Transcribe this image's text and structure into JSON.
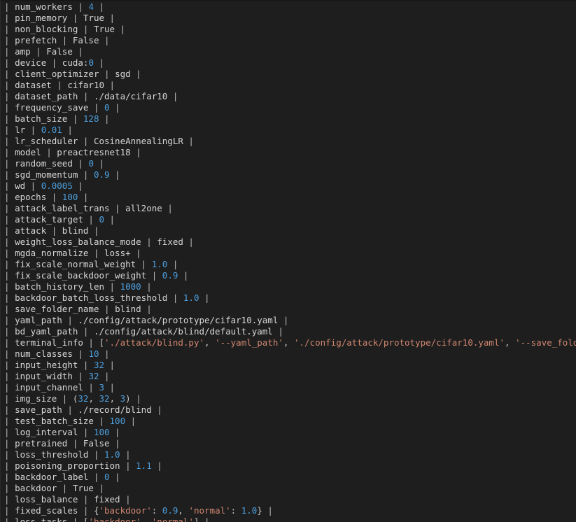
{
  "terminal": {
    "background_color": "#1e1e1e",
    "default_text_color": "#d2d2d2",
    "pipe_color": "#b9b9b9",
    "number_color": "#4d9fdd",
    "string_color": "#d08770",
    "separator": "|",
    "rows": [
      {
        "key": "num_workers",
        "value": "4",
        "value_type": "num"
      },
      {
        "key": "pin_memory",
        "value": "True",
        "value_type": "text"
      },
      {
        "key": "non_blocking",
        "value": "True",
        "value_type": "text"
      },
      {
        "key": "prefetch",
        "value": "False",
        "value_type": "text"
      },
      {
        "key": "amp",
        "value": "False",
        "value_type": "text"
      },
      {
        "key": "device",
        "value": "cuda:0",
        "value_type": "device"
      },
      {
        "key": "client_optimizer",
        "value": "sgd",
        "value_type": "text"
      },
      {
        "key": "dataset",
        "value": "cifar10",
        "value_type": "text"
      },
      {
        "key": "dataset_path",
        "value": "./data/cifar10",
        "value_type": "text"
      },
      {
        "key": "frequency_save",
        "value": "0",
        "value_type": "num"
      },
      {
        "key": "batch_size",
        "value": "128",
        "value_type": "num"
      },
      {
        "key": "lr",
        "value": "0.01",
        "value_type": "num"
      },
      {
        "key": "lr_scheduler",
        "value": "CosineAnnealingLR",
        "value_type": "text"
      },
      {
        "key": "model",
        "value": "preactresnet18",
        "value_type": "text"
      },
      {
        "key": "random_seed",
        "value": "0",
        "value_type": "num"
      },
      {
        "key": "sgd_momentum",
        "value": "0.9",
        "value_type": "num"
      },
      {
        "key": "wd",
        "value": "0.0005",
        "value_type": "num"
      },
      {
        "key": "epochs",
        "value": "100",
        "value_type": "num"
      },
      {
        "key": "attack_label_trans",
        "value": "all2one",
        "value_type": "text"
      },
      {
        "key": "attack_target",
        "value": "0",
        "value_type": "num"
      },
      {
        "key": "attack",
        "value": "blind",
        "value_type": "text"
      },
      {
        "key": "weight_loss_balance_mode",
        "value": "fixed",
        "value_type": "text"
      },
      {
        "key": "mgda_normalize",
        "value": "loss+",
        "value_type": "text"
      },
      {
        "key": "fix_scale_normal_weight",
        "value": "1.0",
        "value_type": "num"
      },
      {
        "key": "fix_scale_backdoor_weight",
        "value": "0.9",
        "value_type": "num"
      },
      {
        "key": "batch_history_len",
        "value": "1000",
        "value_type": "num"
      },
      {
        "key": "backdoor_batch_loss_threshold",
        "value": "1.0",
        "value_type": "num"
      },
      {
        "key": "save_folder_name",
        "value": "blind",
        "value_type": "text"
      },
      {
        "key": "yaml_path",
        "value": "./config/attack/prototype/cifar10.yaml",
        "value_type": "text"
      },
      {
        "key": "bd_yaml_path",
        "value": "./config/attack/blind/default.yaml",
        "value_type": "text"
      },
      {
        "key": "terminal_info",
        "value": "['./attack/blind.py', '--yaml_path', './config/attack/prototype/cifar10.yaml', '--save_folder_name', 'blind']",
        "value_type": "pylist"
      },
      {
        "key": "num_classes",
        "value": "10",
        "value_type": "num"
      },
      {
        "key": "input_height",
        "value": "32",
        "value_type": "num"
      },
      {
        "key": "input_width",
        "value": "32",
        "value_type": "num"
      },
      {
        "key": "input_channel",
        "value": "3",
        "value_type": "num"
      },
      {
        "key": "img_size",
        "value": "(32, 32, 3)",
        "value_type": "pytuple"
      },
      {
        "key": "save_path",
        "value": "./record/blind",
        "value_type": "text"
      },
      {
        "key": "test_batch_size",
        "value": "100",
        "value_type": "num"
      },
      {
        "key": "log_interval",
        "value": "100",
        "value_type": "num"
      },
      {
        "key": "pretrained",
        "value": "False",
        "value_type": "text"
      },
      {
        "key": "loss_threshold",
        "value": "1.0",
        "value_type": "num"
      },
      {
        "key": "poisoning_proportion",
        "value": "1.1",
        "value_type": "num"
      },
      {
        "key": "backdoor_label",
        "value": "0",
        "value_type": "num"
      },
      {
        "key": "backdoor",
        "value": "True",
        "value_type": "text"
      },
      {
        "key": "loss_balance",
        "value": "fixed",
        "value_type": "text"
      },
      {
        "key": "fixed_scales",
        "value": "{'backdoor': 0.9, 'normal': 1.0}",
        "value_type": "pydict"
      },
      {
        "key": "loss_tasks",
        "value": "['backdoor', 'normal']",
        "value_type": "pylist"
      }
    ]
  }
}
